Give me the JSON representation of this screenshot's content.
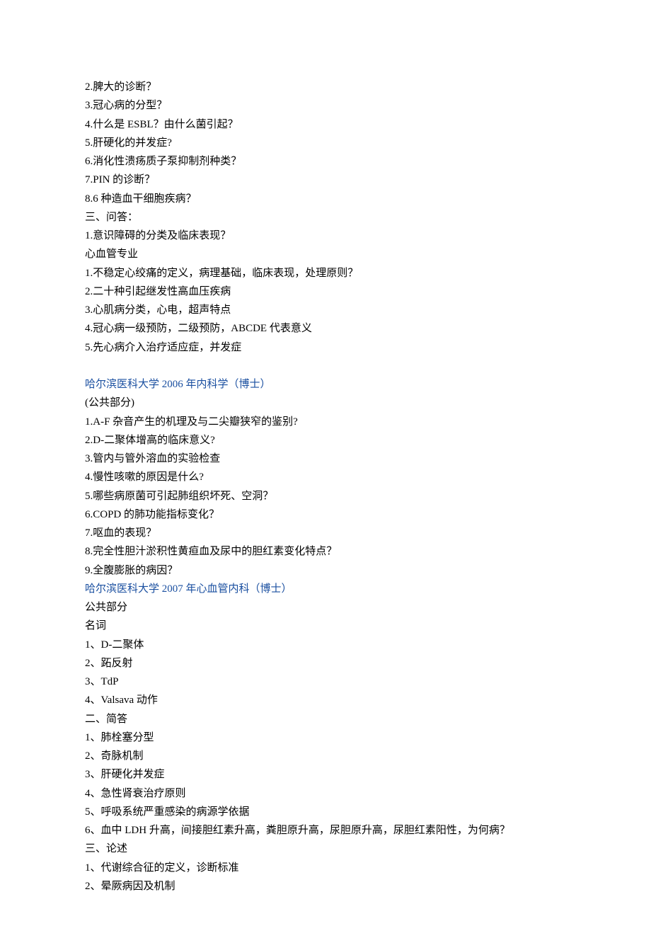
{
  "lines": [
    {
      "text": "2.脾大的诊断？",
      "class": ""
    },
    {
      "text": "3.冠心病的分型？",
      "class": ""
    },
    {
      "text": "4.什么是 ESBL？由什么菌引起？",
      "class": ""
    },
    {
      "text": "5.肝硬化的并发症?",
      "class": ""
    },
    {
      "text": "6.消化性溃疡质子泵抑制剂种类？",
      "class": ""
    },
    {
      "text": "7.PIN 的诊断？",
      "class": ""
    },
    {
      "text": "8.6 种造血干细胞疾病？",
      "class": ""
    },
    {
      "text": "三、问答：",
      "class": ""
    },
    {
      "text": "1.意识障碍的分类及临床表现？",
      "class": ""
    },
    {
      "text": "心血管专业",
      "class": ""
    },
    {
      "text": "1.不稳定心绞痛的定义，病理基础，临床表现，处理原则？",
      "class": ""
    },
    {
      "text": "2.二十种引起继发性高血压疾病",
      "class": ""
    },
    {
      "text": "3.心肌病分类，心电，超声特点",
      "class": ""
    },
    {
      "text": "4.冠心病一级预防，二级预防，ABCDE 代表意义",
      "class": ""
    },
    {
      "text": "5.先心病介入治疗适应症，并发症",
      "class": ""
    },
    {
      "text": "",
      "class": ""
    },
    {
      "text": "哈尔滨医科大学 2006 年内科学（博士）",
      "class": "heading"
    },
    {
      "text": "(公共部分)",
      "class": ""
    },
    {
      "text": "1.A-F 杂音产生的机理及与二尖瓣狭窄的鉴别?",
      "class": ""
    },
    {
      "text": "2.D-二聚体增高的临床意义?",
      "class": ""
    },
    {
      "text": "3.管内与管外溶血的实验检查",
      "class": ""
    },
    {
      "text": "4.慢性咳嗽的原因是什么?",
      "class": ""
    },
    {
      "text": "5.哪些病原菌可引起肺组织坏死、空洞？",
      "class": ""
    },
    {
      "text": "6.COPD 的肺功能指标变化？",
      "class": ""
    },
    {
      "text": "7.呕血的表现？",
      "class": ""
    },
    {
      "text": "8.完全性胆汁淤积性黄疸血及尿中的胆红素变化特点？",
      "class": ""
    },
    {
      "text": "9.全腹膨胀的病因？",
      "class": ""
    },
    {
      "text": "哈尔滨医科大学 2007 年心血管内科（博士）",
      "class": "heading-blue"
    },
    {
      "text": "公共部分",
      "class": ""
    },
    {
      "text": "名词",
      "class": ""
    },
    {
      "text": "1、D-二聚体",
      "class": ""
    },
    {
      "text": "2、跖反射",
      "class": ""
    },
    {
      "text": "3、TdP",
      "class": ""
    },
    {
      "text": "4、Valsava 动作",
      "class": ""
    },
    {
      "text": "二、简答",
      "class": ""
    },
    {
      "text": "1、肺栓塞分型",
      "class": ""
    },
    {
      "text": "2、奇脉机制",
      "class": ""
    },
    {
      "text": "3、肝硬化并发症",
      "class": ""
    },
    {
      "text": "4、急性肾衰治疗原则",
      "class": ""
    },
    {
      "text": "5、呼吸系统严重感染的病源学依据",
      "class": ""
    },
    {
      "text": "6、血中 LDH 升高，间接胆红素升高，粪胆原升高，尿胆原升高，尿胆红素阳性，为何病？",
      "class": ""
    },
    {
      "text": "三、论述",
      "class": ""
    },
    {
      "text": "1、代谢综合征的定义，诊断标准",
      "class": ""
    },
    {
      "text": "2、晕厥病因及机制",
      "class": ""
    }
  ]
}
